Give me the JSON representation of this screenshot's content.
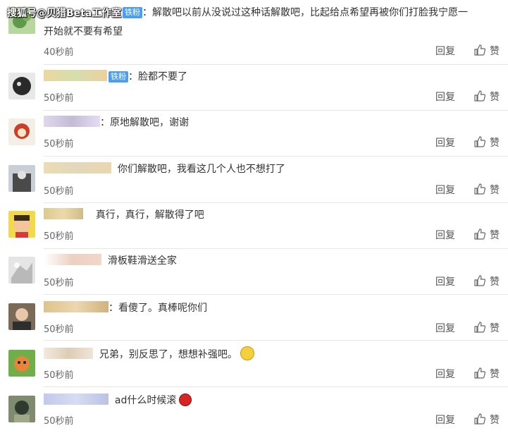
{
  "watermark": "搜狐号@贝猎Beta工作室",
  "actions": {
    "reply": "回复",
    "like": "赞"
  },
  "comments": [
    {
      "badge": "铁粉",
      "text": "：解散吧以前从没说过这种话解散吧，比起给点希望再被你们打脸我宁愿一",
      "text2": "开始就不要有希望",
      "time": "40秒前"
    },
    {
      "badge": "铁粉",
      "text": "：脸都不要了",
      "time": "50秒前"
    },
    {
      "text": "：原地解散吧，谢谢",
      "time": "50秒前"
    },
    {
      "text": "你们解散吧，我看这几个人也不想打了",
      "time": "50秒前"
    },
    {
      "text": "真行，真行，解散得了吧",
      "time": "50秒前"
    },
    {
      "text": "滑板鞋滑送全家",
      "time": "50秒前"
    },
    {
      "text": "：看傻了。真棒呢你们",
      "time": "50秒前"
    },
    {
      "text": "兄弟，别反思了，想想补强吧。",
      "time": "50秒前"
    },
    {
      "text": "ad什么时候滚",
      "time": "50秒前"
    }
  ]
}
